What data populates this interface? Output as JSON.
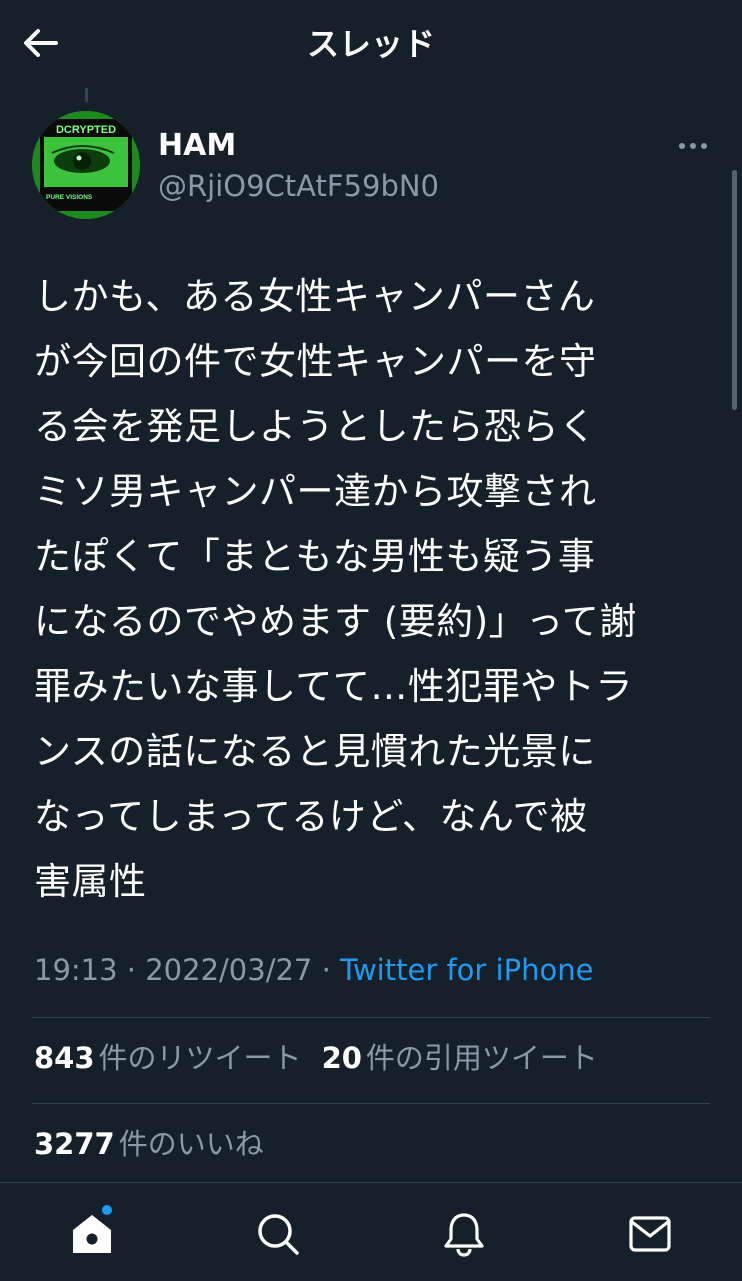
{
  "header": {
    "title": "スレッド"
  },
  "tweet": {
    "avatar_text": "DCRYPTED",
    "avatar_subtext": "PURE VISIONS",
    "display_name": "HAM",
    "handle": "@RjiO9CtAtF59bN0",
    "text": "しかも、ある女性キャンパーさん\nが今回の件で女性キャンパーを守\nる会を発足しようとしたら恐らく\nミソ男キャンパー達から攻撃され\nたぽくて「まともな男性も疑う事\nになるのでやめます (要約)」って謝\n罪みたいな事してて…性犯罪やトラ\nンスの話になると見慣れた光景に\nなってしまってるけど、なんで被\n害属性",
    "time": "19:13",
    "separator": " · ",
    "date": "2022/03/27",
    "source": "Twitter for iPhone"
  },
  "stats": {
    "retweets_count": "843",
    "retweets_label": "件のリツイート",
    "quotes_count": "20",
    "quotes_label": "件の引用ツイート",
    "likes_count": "3277",
    "likes_label": "件のいいね"
  },
  "tabs": [
    {
      "icon": "home-icon",
      "has_notification": true
    },
    {
      "icon": "search-icon"
    },
    {
      "icon": "bell-icon"
    },
    {
      "icon": "mail-icon"
    }
  ],
  "colors": {
    "background": "#15202b",
    "accent": "#1d9bf0",
    "secondary_text": "#8b98a5",
    "divider": "#38444d"
  }
}
